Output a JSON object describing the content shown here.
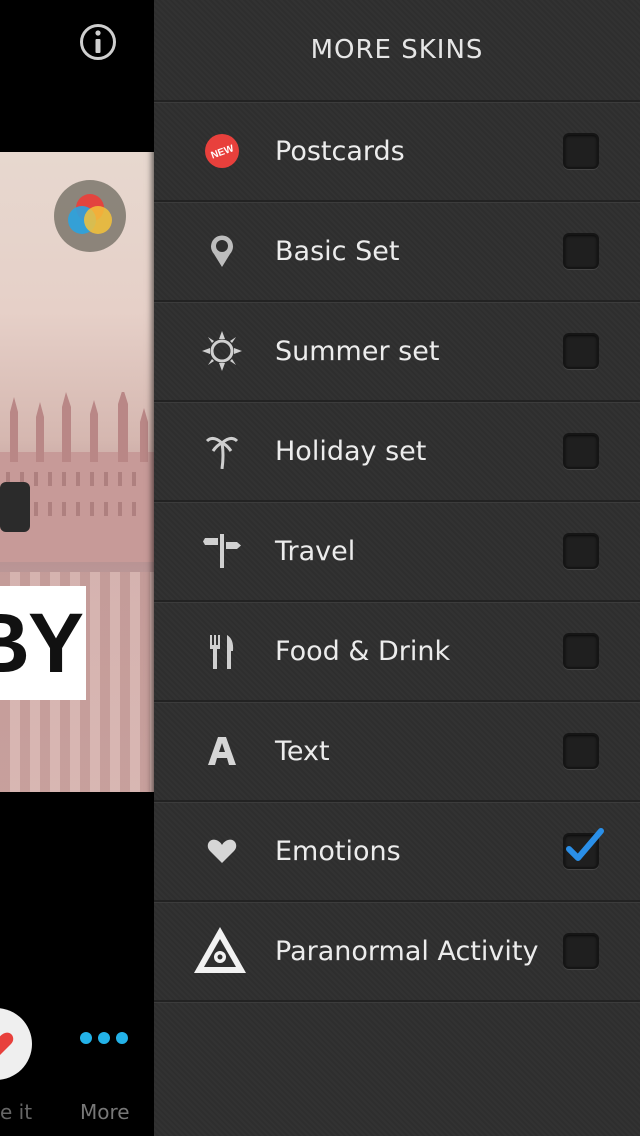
{
  "left_screen": {
    "info_icon": "info-circle-icon",
    "overlay_text": "BY",
    "bottom_left_label": "e it",
    "more_label": "More"
  },
  "menu": {
    "title": "MORE SKINS",
    "items": [
      {
        "label": "Postcards",
        "icon": "new-badge-icon",
        "checked": false
      },
      {
        "label": "Basic Set",
        "icon": "map-pin-icon",
        "checked": false
      },
      {
        "label": "Summer set",
        "icon": "sun-icon",
        "checked": false
      },
      {
        "label": "Holiday set",
        "icon": "palm-tree-icon",
        "checked": false
      },
      {
        "label": "Travel",
        "icon": "signpost-icon",
        "checked": false
      },
      {
        "label": "Food & Drink",
        "icon": "fork-knife-icon",
        "checked": false
      },
      {
        "label": "Text",
        "icon": "letter-a-icon",
        "checked": false
      },
      {
        "label": "Emotions",
        "icon": "heart-icon",
        "checked": true
      },
      {
        "label": "Paranormal Activity",
        "icon": "triangle-eye-icon",
        "checked": false
      }
    ],
    "new_badge_text": "NEW"
  },
  "colors": {
    "panel_bg": "#2f2f2f",
    "checkmark": "#2a8fe8",
    "more_dots": "#23b2e8",
    "new_badge": "#e8403c"
  }
}
